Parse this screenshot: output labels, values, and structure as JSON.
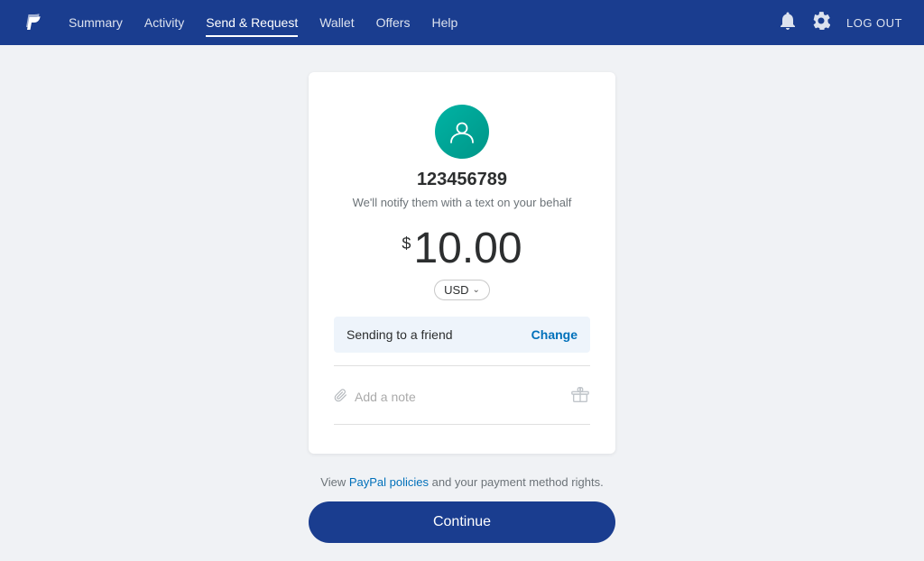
{
  "nav": {
    "links": [
      {
        "id": "summary",
        "label": "Summary",
        "active": false
      },
      {
        "id": "activity",
        "label": "Activity",
        "active": false
      },
      {
        "id": "send-request",
        "label": "Send & Request",
        "active": true
      },
      {
        "id": "wallet",
        "label": "Wallet",
        "active": false
      },
      {
        "id": "offers",
        "label": "Offers",
        "active": false
      },
      {
        "id": "help",
        "label": "Help",
        "active": false
      }
    ],
    "logout_label": "LOG OUT"
  },
  "recipient": {
    "name": "123456789",
    "note": "We'll notify them with a text on your behalf"
  },
  "amount": {
    "currency_symbol": "$",
    "value": "10.00",
    "currency": "USD"
  },
  "send_type": {
    "label": "Sending to a friend",
    "change_label": "Change"
  },
  "note_input": {
    "placeholder": "Add a note"
  },
  "footer": {
    "policies_pre": "View ",
    "policies_link": "PayPal policies",
    "policies_post": " and your payment method rights.",
    "continue_label": "Continue"
  }
}
